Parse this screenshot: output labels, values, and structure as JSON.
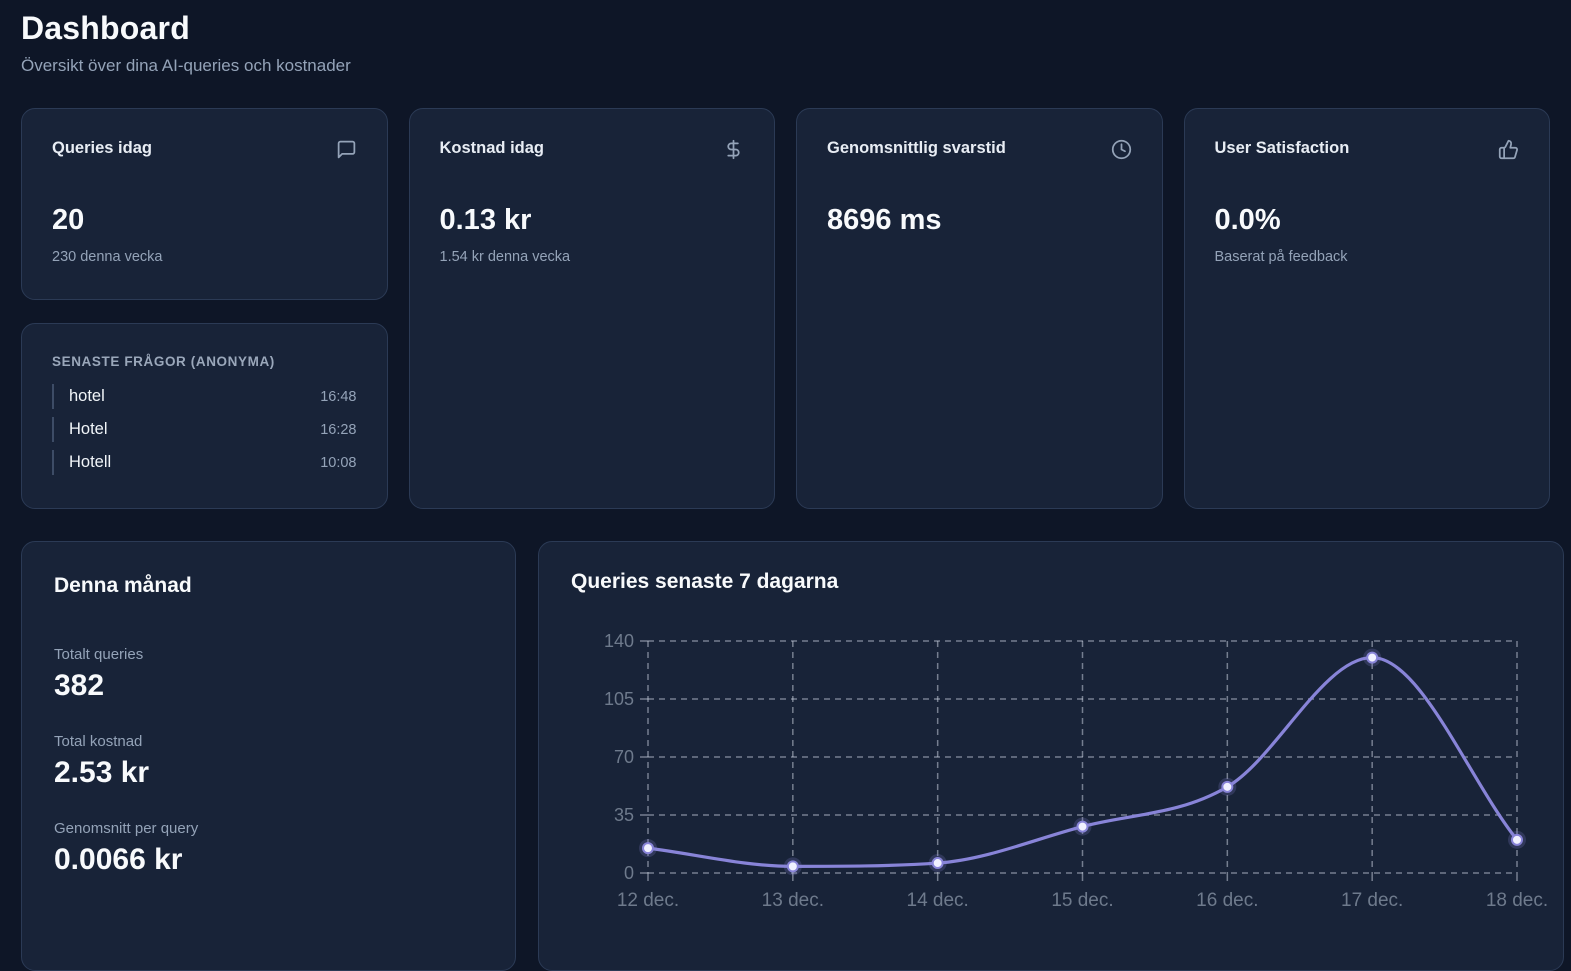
{
  "page": {
    "title": "Dashboard",
    "subtitle": "Översikt över dina AI-queries och kostnader"
  },
  "stat_cards": [
    {
      "label": "Queries idag",
      "icon": "message-square-icon",
      "value": "20",
      "sub": "230 denna vecka"
    },
    {
      "label": "Kostnad idag",
      "icon": "dollar-sign-icon",
      "value": "0.13 kr",
      "sub": "1.54 kr denna vecka"
    },
    {
      "label": "Genomsnittlig svarstid",
      "icon": "clock-icon",
      "value": "8696 ms",
      "sub": ""
    },
    {
      "label": "User Satisfaction",
      "icon": "thumbs-up-icon",
      "value": "0.0%",
      "sub": "Baserat på feedback"
    }
  ],
  "recent_queries": {
    "title": "SENASTE FRÅGOR (ANONYMA)",
    "items": [
      {
        "text": "hotel",
        "time": "16:48"
      },
      {
        "text": "Hotel",
        "time": "16:28"
      },
      {
        "text": "Hotell",
        "time": "10:08"
      }
    ]
  },
  "month_summary": {
    "title": "Denna månad",
    "stats": [
      {
        "label": "Totalt queries",
        "value": "382"
      },
      {
        "label": "Total kostnad",
        "value": "2.53 kr"
      },
      {
        "label": "Genomsnitt per query",
        "value": "0.0066 kr"
      }
    ]
  },
  "chart_card": {
    "title": "Queries senaste 7 dagarna"
  },
  "chart_data": {
    "type": "line",
    "title": "Queries senaste 7 dagarna",
    "x": [
      "12 dec.",
      "13 dec.",
      "14 dec.",
      "15 dec.",
      "16 dec.",
      "17 dec.",
      "18 dec."
    ],
    "series": [
      {
        "name": "queries",
        "values": [
          15,
          4,
          6,
          28,
          52,
          130,
          20
        ]
      }
    ],
    "ylim": [
      0,
      140
    ],
    "yticks": [
      0,
      35,
      70,
      105,
      140
    ],
    "grid": "dashed",
    "legend": false,
    "smooth": true,
    "line_color": "#8884d8",
    "dot_fill": "#f0f1ff",
    "grid_color": "#c3cbd9",
    "axis_label_color": "#6e7a8c"
  },
  "colors": {
    "page_bg": "#0e1627",
    "card_bg": "#182338",
    "card_border": "#2b3a55",
    "accent": "#8884d8",
    "text_primary": "#f8fafc",
    "text_muted": "#94a3b8"
  }
}
